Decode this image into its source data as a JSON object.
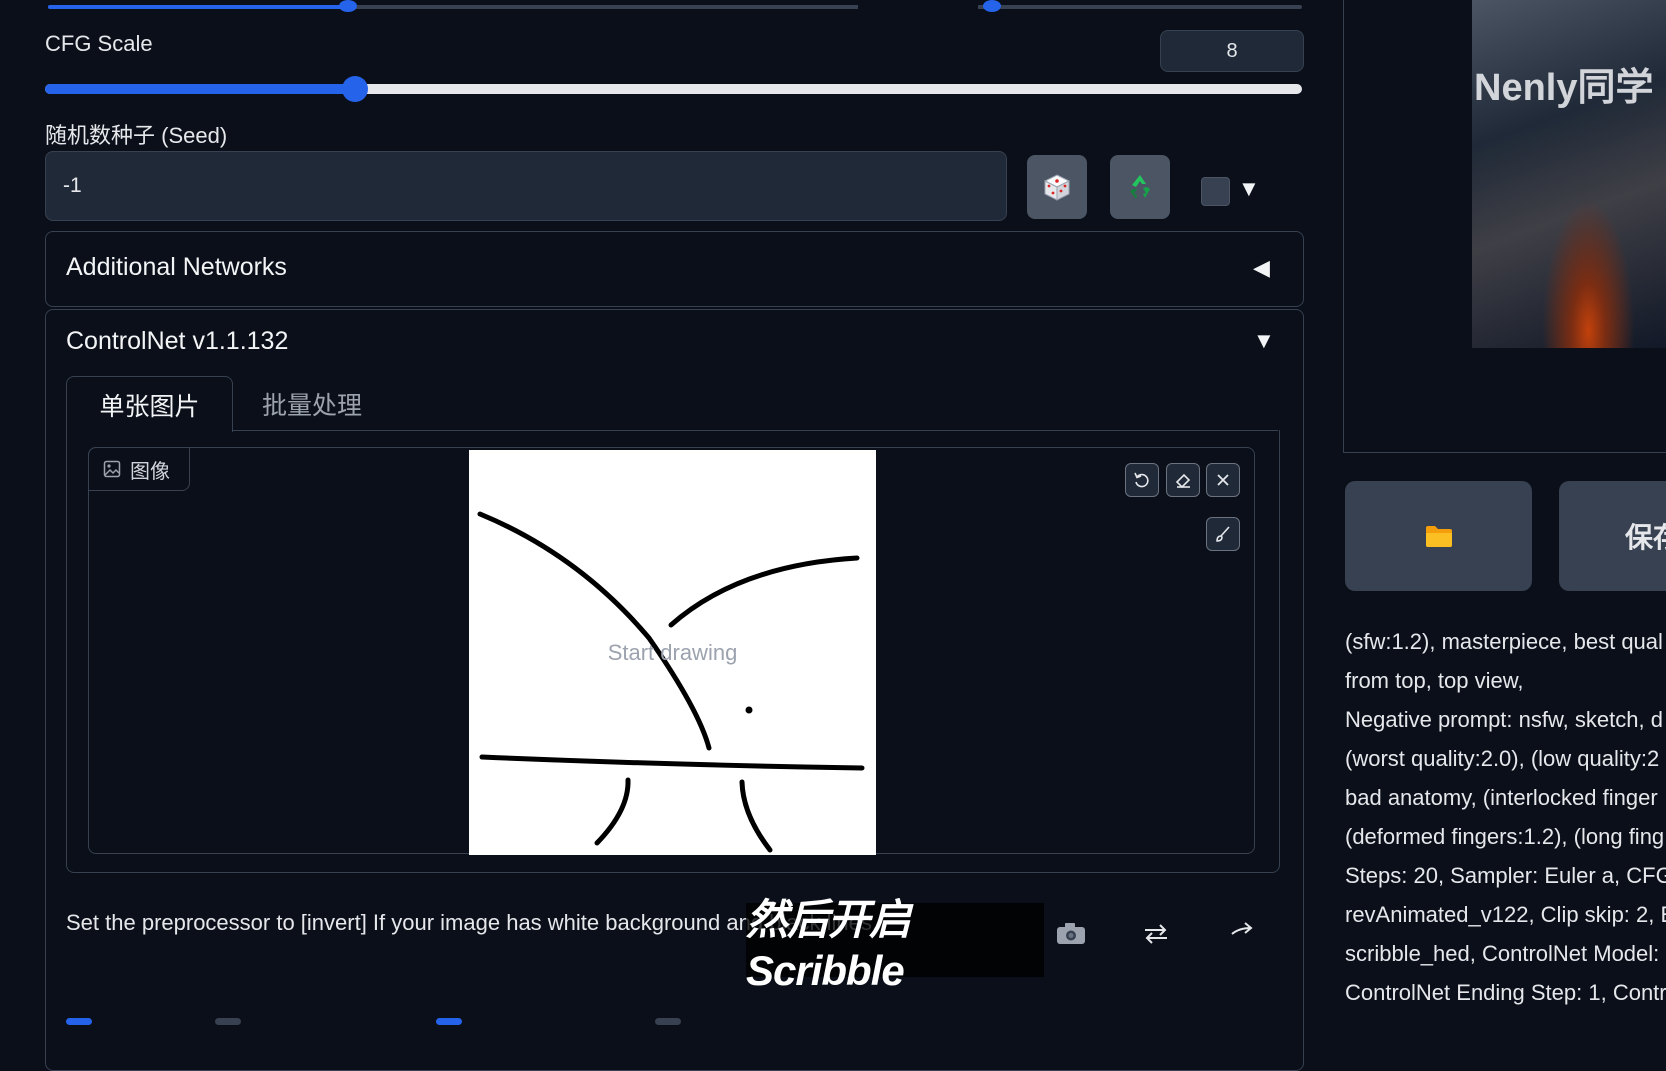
{
  "cfg": {
    "label": "CFG Scale",
    "value": "8",
    "level_fraction": 0.25
  },
  "seed": {
    "label": "随机数种子 (Seed)",
    "value": "-1",
    "dice_icon": "dice-icon",
    "recycle_icon": "recycle-icon",
    "dropdown_arrow": "▼"
  },
  "additional_networks": {
    "title": "Additional Networks",
    "arrow": "◀"
  },
  "controlnet": {
    "title": "ControlNet v1.1.132",
    "arrow": "▼",
    "tabs": [
      {
        "label": "单张图片"
      },
      {
        "label": "批量处理"
      }
    ],
    "image_label": "图像",
    "canvas_placeholder": "Start drawing",
    "hint": "Set the preprocessor to [invert] If your image has white background and black lines."
  },
  "subtitle": "然后开启Scribble",
  "watermark": "Nenly同学",
  "actions": {
    "save_label": "保存"
  },
  "info_lines": [
    "(sfw:1.2), masterpiece, best qual",
    "from top, top view,",
    "Negative prompt: nsfw, sketch, d",
    "(worst quality:2.0), (low quality:2",
    "bad anatomy, (interlocked finger",
    "(deformed fingers:1.2), (long fing",
    "Steps: 20, Sampler: Euler a, CFG",
    "revAnimated_v122, Clip skip: 2, E",
    "scribble_hed, ControlNet Model:",
    "ControlNet Ending Step: 1, Contr"
  ],
  "colors": {
    "accent": "#2563eb",
    "background": "#0b0f19",
    "panel": "#1f2937",
    "border": "#374151"
  }
}
